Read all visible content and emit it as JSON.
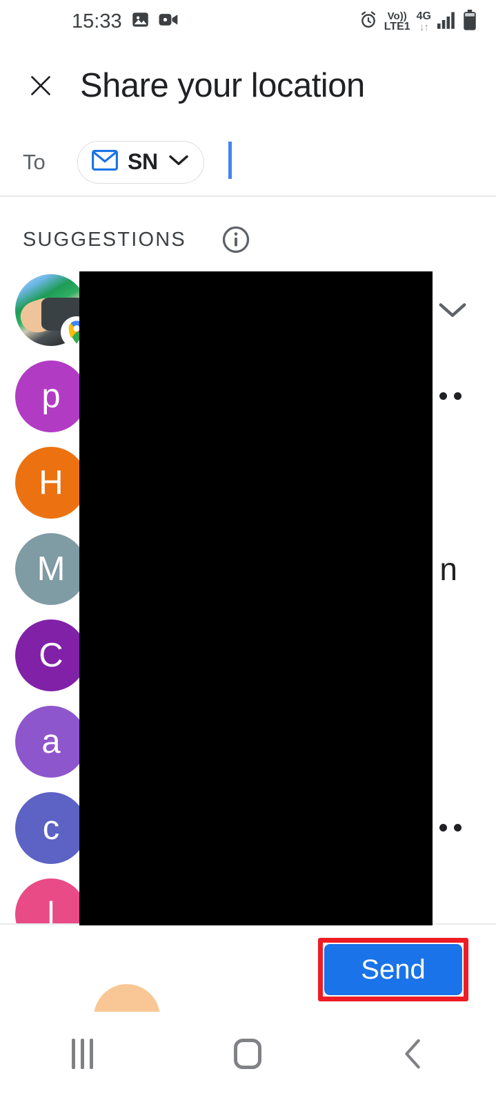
{
  "status_bar": {
    "time": "15:33",
    "left_icons": [
      "image-icon",
      "video-camera-icon"
    ],
    "alarm_icon": "alarm-clock-icon",
    "volte_top": "Vo))",
    "volte_bottom": "LTE1",
    "network_label": "4G",
    "data_arrows": "↓↑",
    "signal_icon": "signal-bars-icon",
    "battery_icon": "battery-icon"
  },
  "header": {
    "close_icon": "close-icon",
    "title": "Share your location"
  },
  "to_field": {
    "label": "To",
    "chip": {
      "icon": "envelope-icon",
      "name": "SN",
      "expand_icon": "chevron-down-icon"
    },
    "caret_color": "#4285f4"
  },
  "suggestions": {
    "header_label": "SUGGESTIONS",
    "info_icon": "info-icon",
    "rows": [
      {
        "avatar_type": "photo",
        "avatar_letter": "",
        "avatar_color": "#3a9f5c",
        "badge": "google-maps-pin-icon",
        "trailing": "chevron-down-icon",
        "trailing_text": ""
      },
      {
        "avatar_type": "letter",
        "avatar_letter": "p",
        "avatar_color": "#b23bc4",
        "badge": "",
        "trailing": "ellipsis",
        "trailing_text": ""
      },
      {
        "avatar_type": "letter",
        "avatar_letter": "H",
        "avatar_color": "#ec7211",
        "badge": "",
        "trailing": "",
        "trailing_text": ""
      },
      {
        "avatar_type": "letter",
        "avatar_letter": "M",
        "avatar_color": "#7f9ba4",
        "badge": "",
        "trailing": "text",
        "trailing_text": "n"
      },
      {
        "avatar_type": "letter",
        "avatar_letter": "C",
        "avatar_color": "#8021a8",
        "badge": "",
        "trailing": "",
        "trailing_text": ""
      },
      {
        "avatar_type": "letter",
        "avatar_letter": "a",
        "avatar_color": "#8e56cd",
        "badge": "",
        "trailing": "",
        "trailing_text": ""
      },
      {
        "avatar_type": "letter",
        "avatar_letter": "c",
        "avatar_color": "#5c63c4",
        "badge": "",
        "trailing": "ellipsis",
        "trailing_text": ""
      },
      {
        "avatar_type": "letter",
        "avatar_letter": "l",
        "avatar_color": "#e84b86",
        "badge": "",
        "trailing": "",
        "trailing_text": ""
      }
    ]
  },
  "footer": {
    "send_label": "Send",
    "send_color": "#1a73e8",
    "highlight_color": "#ee1c25"
  },
  "nav_bar": {
    "recents_icon": "recents-icon",
    "home_icon": "home-icon",
    "back_icon": "back-icon"
  }
}
